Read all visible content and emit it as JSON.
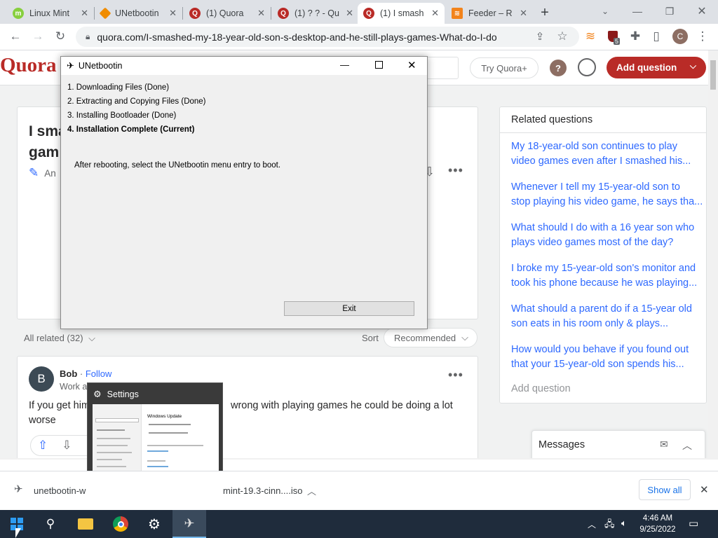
{
  "browser": {
    "tabs": [
      {
        "label": "Linux Mint",
        "icon": "linux-mint-icon",
        "color": "#87cf3e"
      },
      {
        "label": "UNetbootin",
        "icon": "unetbootin-favicon",
        "color": "#f08c00"
      },
      {
        "label": "(1) Quora",
        "icon": "quora-favicon",
        "color": "#b92b27"
      },
      {
        "label": "(1) ? ? - Qu",
        "icon": "quora-favicon",
        "color": "#b92b27"
      },
      {
        "label": "(1) I smash",
        "icon": "quora-favicon",
        "color": "#b92b27"
      },
      {
        "label": "Feeder – R",
        "icon": "rss-favicon",
        "color": "#f2831b"
      }
    ],
    "new_tab": "+",
    "url": "quora.com/I-smashed-my-18-year-old-son-s-desktop-and-he-still-plays-games-What-do-I-do",
    "extension_badge": "5",
    "profile_initial": "C"
  },
  "quora": {
    "logo": "Quora",
    "try_plus": "Try Quora+",
    "help": "?",
    "add_question_btn": "Add question",
    "question_title_line1": "I sma",
    "question_title_line2": "gam",
    "answer_label": "An",
    "all_related": "All related (32)",
    "sort_label": "Sort",
    "sort_value": "Recommended",
    "answer": {
      "avatar_initial": "B",
      "author": "Bob",
      "follow": "Follow",
      "credential": "Work at a grocery store · 2h",
      "text_line1": "If you get him",
      "text_tail1": "wrong with playing games he could be doing a lot",
      "text_line2": "worse"
    },
    "related_questions": {
      "heading": "Related questions",
      "items": [
        {
          "line1": "My 18-year-old son continues to play",
          "line2": "video games even after I smashed his..."
        },
        {
          "line1": "Whenever I tell my 15-year-old son to",
          "line2": "stop playing his video game, he says tha..."
        },
        {
          "line1": "What should I do with a 16 year son who",
          "line2": "plays video games most of the day?"
        },
        {
          "line1": "I broke my 15-year-old son's monitor and",
          "line2": "took his phone because he was playing..."
        },
        {
          "line1": "What should a parent do if a 15-year old",
          "line2": "son eats in his room only & plays..."
        },
        {
          "line1": "How would you behave if you found out",
          "line2": "that your 15-year-old son spends his..."
        }
      ],
      "add_question": "Add question"
    },
    "messages": "Messages"
  },
  "unetbootin": {
    "title": "UNetbootin",
    "steps": [
      "1. Downloading Files (Done)",
      "2. Extracting and Copying Files (Done)",
      "3. Installing Bootloader (Done)",
      "4. Installation Complete (Current)"
    ],
    "message": "After rebooting, select the UNetbootin menu entry to boot.",
    "exit_label": "Exit"
  },
  "settings_preview": {
    "title": "Settings",
    "panel_heading": "Windows Update"
  },
  "download_bar": {
    "item1": "unetbootin-w",
    "item2": "mint-19.3-cinn....iso",
    "show_all": "Show all"
  },
  "taskbar": {
    "time": "4:46 AM",
    "date": "9/25/2022"
  }
}
